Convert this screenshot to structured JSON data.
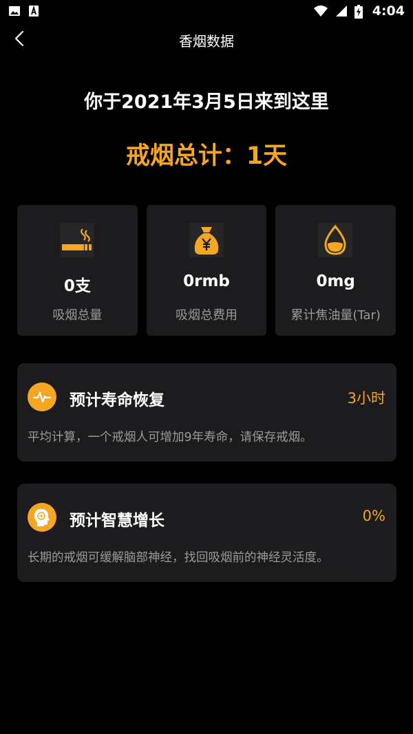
{
  "status_bar": {
    "time": "4:04",
    "left_icons": [
      "image-icon",
      "font-download-icon"
    ],
    "right_icons": [
      "wifi-icon",
      "signal-icon",
      "battery-charging-icon"
    ]
  },
  "header": {
    "title": "香烟数据",
    "back_icon": "chevron-left-icon"
  },
  "hero": {
    "arrival_text": "你于2021年3月5日来到这里",
    "total_text": "戒烟总计：1天"
  },
  "stats": [
    {
      "icon": "cigarette-icon",
      "value": "0支",
      "label": "吸烟总量"
    },
    {
      "icon": "money-bag-icon",
      "value": "0rmb",
      "label": "吸烟总费用"
    },
    {
      "icon": "oil-drop-icon",
      "value": "0mg",
      "label": "累计焦油量(Tar)"
    }
  ],
  "cards": [
    {
      "icon": "heartbeat-icon",
      "title": "预计寿命恢复",
      "value": "3小时",
      "description": "平均计算，一个戒烟人可增加9年寿命，请保存戒烟。"
    },
    {
      "icon": "brain-head-icon",
      "title": "预计智慧增长",
      "value": "0%",
      "description": "长期的戒烟可缓解脑部神经，找回吸烟前的神经灵活度。"
    }
  ],
  "colors": {
    "accent": "#f5a623",
    "background": "#000000",
    "card": "#1c1c1e",
    "muted_text": "#9a9a9a"
  }
}
